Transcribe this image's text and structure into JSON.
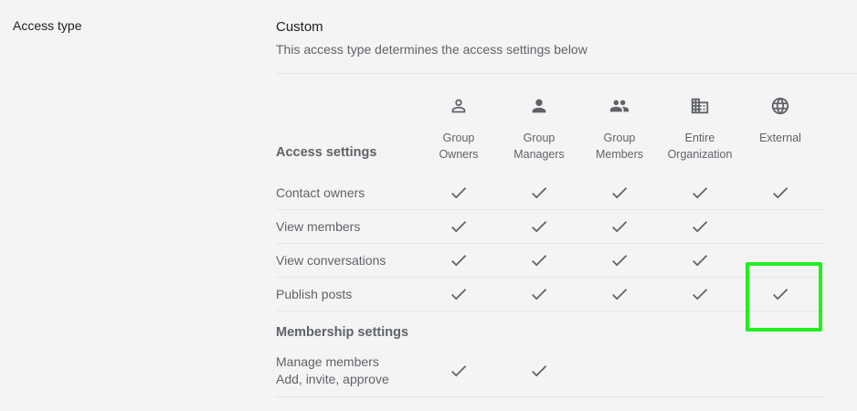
{
  "section_label": "Access type",
  "access": {
    "title": "Custom",
    "description": "This access type determines the access settings below"
  },
  "access_settings_heading": "Access settings",
  "membership_settings_heading": "Membership settings",
  "columns": [
    {
      "icon": "person-outline-icon",
      "label_line1": "Group",
      "label_line2": "Owners"
    },
    {
      "icon": "person-icon",
      "label_line1": "Group",
      "label_line2": "Managers"
    },
    {
      "icon": "people-icon",
      "label_line1": "Group",
      "label_line2": "Members"
    },
    {
      "icon": "building-icon",
      "label_line1": "Entire",
      "label_line2": "Organization"
    },
    {
      "icon": "globe-icon",
      "label_line1": "External",
      "label_line2": ""
    }
  ],
  "access_rows": [
    {
      "label": "Contact owners",
      "checks": [
        true,
        true,
        true,
        true,
        true
      ]
    },
    {
      "label": "View members",
      "checks": [
        true,
        true,
        true,
        true,
        false
      ]
    },
    {
      "label": "View conversations",
      "checks": [
        true,
        true,
        true,
        true,
        false
      ]
    },
    {
      "label": "Publish posts",
      "checks": [
        true,
        true,
        true,
        true,
        true
      ]
    }
  ],
  "membership_rows": [
    {
      "label": "Manage members",
      "sublabel": "Add, invite, approve",
      "checks": [
        true,
        true,
        false,
        false,
        false
      ]
    }
  ],
  "colors": {
    "background": "#f4f4f4",
    "text_secondary": "#5f6368",
    "highlight": "#22f01f"
  }
}
